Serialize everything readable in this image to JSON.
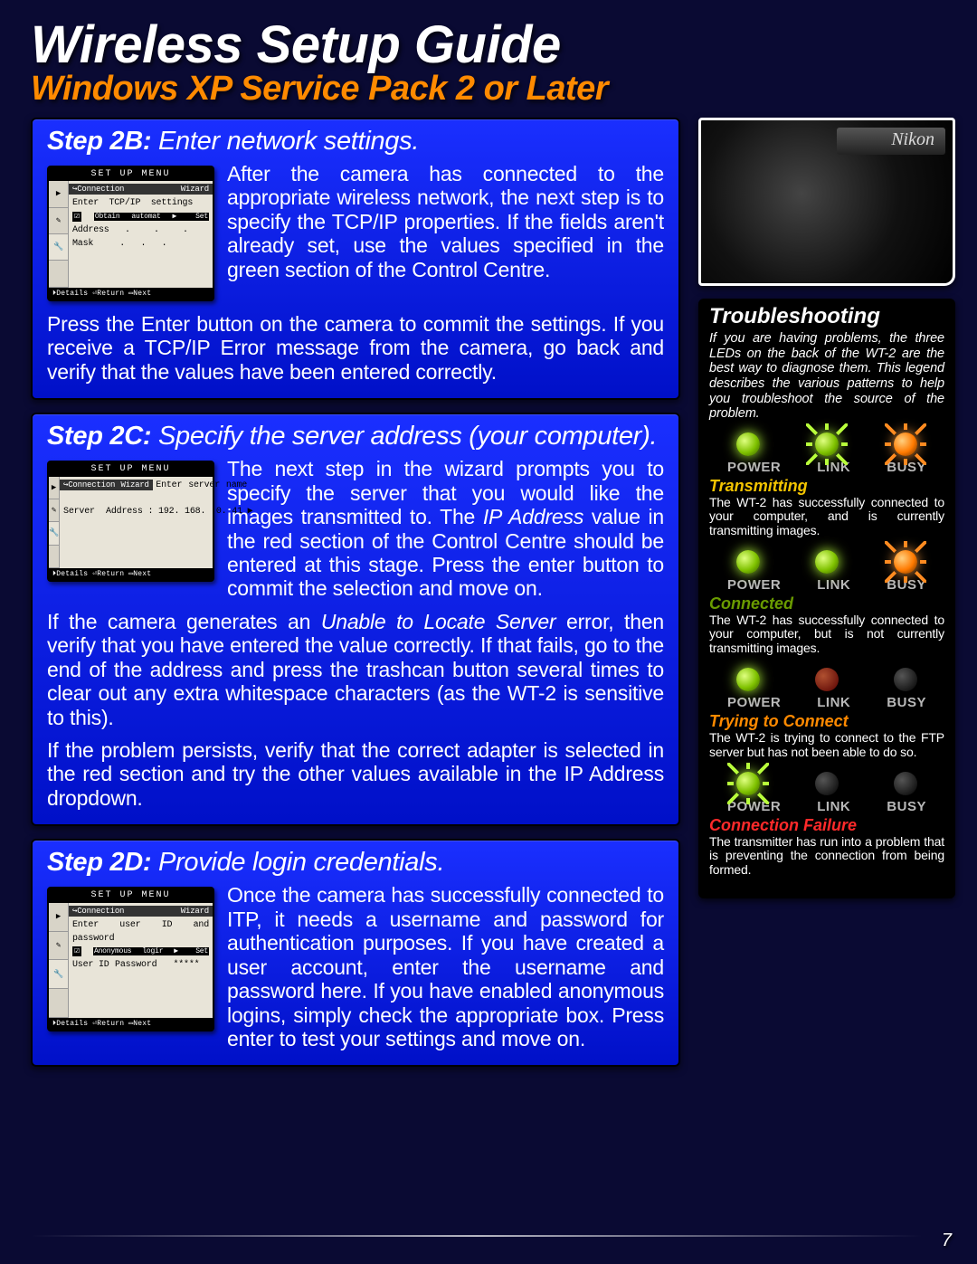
{
  "header": {
    "title": "Wireless Setup Guide",
    "subtitle": "Windows XP Service Pack 2 or Later"
  },
  "steps": {
    "s2b": {
      "label": "Step 2B:",
      "head": "Enter network settings.",
      "p1": "After the camera has connected to the appropriate wireless network, the next step is to specify the TCP/IP properties.  If the fields aren't already set, use the values specified in the green section of the Control Centre.",
      "p2": "Press the Enter button on the camera to commit the settings.  If you receive a TCP/IP Error message from the camera, go back and verify that the values have been entered correctly.",
      "screen": {
        "title": "SET UP MENU",
        "sub": "Connection Wizard",
        "line0": "Enter TCP/IP settings",
        "opt": "Obtain automat ▶ Set",
        "addr_l": "Address",
        "addr_v": ".   .   .   ",
        "mask_l": "Mask",
        "mask_v": ".   .   .   ",
        "foot": "⏵Details ⏎Return ▭Next"
      }
    },
    "s2c": {
      "label": "Step 2C:",
      "head": "Specify the server address (your computer).",
      "p1a": "The next step in the wizard prompts you to specify the server that you would like the images transmitted to.  The ",
      "p1i": "IP Address",
      "p1b": " value in the red section of the Control Centre should be entered at this stage.  Press the enter button to commit the selection and move on.",
      "p2a": "If the camera generates an ",
      "p2i": "Unable to Locate Server",
      "p2b": " error, then verify that you have entered the value correctly.  If that fails, go to the end of the address and press the trashcan button several times to clear out any extra whitespace characters (as the WT-2 is sensitive to this).",
      "p3": "If the problem persists, verify that the correct adapter is selected in the red section and try the other values available in the IP Address dropdown.",
      "screen": {
        "title": "SET UP MENU",
        "sub": "Connection Wizard",
        "line0": "Enter server name",
        "srv_l": "Server",
        "addr": "Address : 192. 168.  0. 41 ▶",
        "foot": "⏵Details ⏎Return ▭Next"
      }
    },
    "s2d": {
      "label": "Step 2D:",
      "head": "Provide login credentials.",
      "p1": "Once the camera has successfully connected to ITP, it needs a username and password for authentication purposes.  If you have created a user account, enter the username and password here.  If you have enabled anonymous logins, simply check the appropriate box.  Press enter to test your settings and move on.",
      "screen": {
        "title": "SET UP MENU",
        "sub": "Connection Wizard",
        "line0": "Enter user ID and",
        "line1": "password",
        "opt": "Anonymous logir ▶ Set",
        "uid_l": "User ID",
        "pwd_l": "Password",
        "pwd_v": "*****",
        "foot": "⏵Details ⏎Return ▭Next"
      }
    }
  },
  "sidebar": {
    "camera_brand": "Nikon",
    "ts_title": "Troubleshooting",
    "ts_intro": "If you are having problems, the three LEDs on the back of the WT-2 are the best way to diagnose them.  This legend describes the various patterns to help you troubleshoot the source of the problem.",
    "labels": {
      "power": "POWER",
      "link": "LINK",
      "busy": "BUSY"
    },
    "states": {
      "transmitting": {
        "name": "Transmitting",
        "desc": "The WT-2 has successfully connected to your computer, and is currently transmitting images."
      },
      "connected": {
        "name": "Connected",
        "desc": "The WT-2 has successfully connected to your computer, but is not currently transmitting images."
      },
      "trying": {
        "name": "Trying to Connect",
        "desc": "The WT-2 is trying to connect to the FTP server but has not been able to do so."
      },
      "failure": {
        "name": "Connection Failure",
        "desc": "The transmitter has run into a problem that is preventing the connection from being formed."
      }
    }
  },
  "page_number": "7"
}
